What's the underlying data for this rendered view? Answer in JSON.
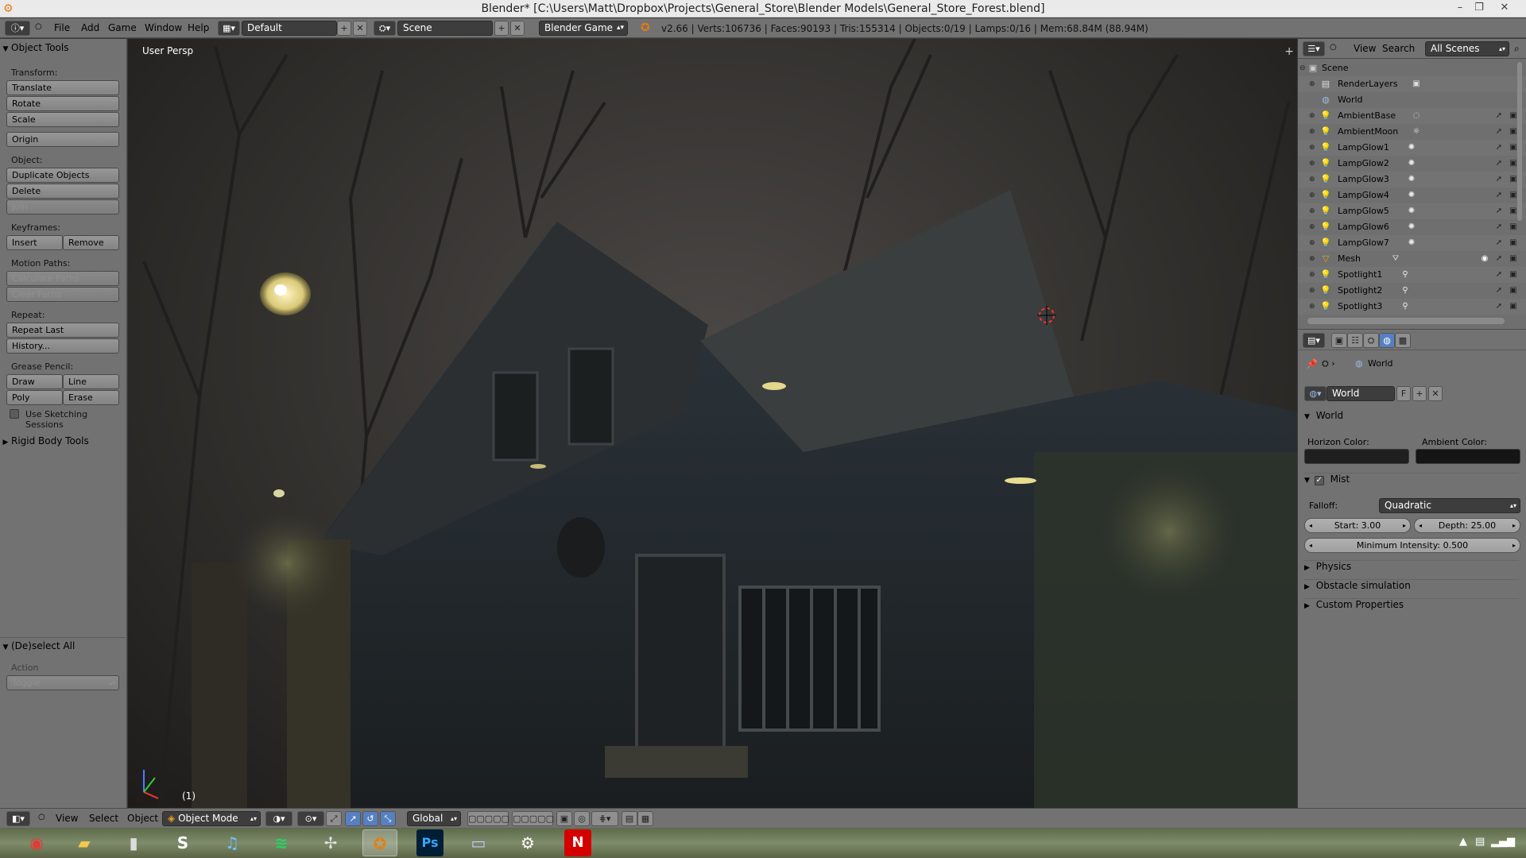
{
  "window": {
    "title": "Blender* [C:\\Users\\Matt\\Dropbox\\Projects\\General_Store\\Blender Models\\General_Store_Forest.blend]",
    "minimize": "–",
    "maximize": "❐",
    "close": "✕"
  },
  "info_header": {
    "menus": [
      "File",
      "Add",
      "Game",
      "Window",
      "Help"
    ],
    "screen_layout": "Default",
    "scene": "Scene",
    "engine": "Blender Game",
    "stats": "v2.66 | Verts:106736 | Faces:90193 | Tris:155314 | Objects:0/19 | Lamps:0/16 | Mem:68.84M (88.94M)"
  },
  "toolshelf": {
    "title": "Object Tools",
    "transform_label": "Transform:",
    "translate": "Translate",
    "rotate": "Rotate",
    "scale": "Scale",
    "origin": "Origin",
    "object_label": "Object:",
    "duplicate": "Duplicate Objects",
    "delete": "Delete",
    "join": "Join",
    "keyframes_label": "Keyframes:",
    "insert": "Insert",
    "remove": "Remove",
    "motion_label": "Motion Paths:",
    "calculate_paths": "Calculate Paths",
    "clear_paths": "Clear Paths",
    "repeat_label": "Repeat:",
    "repeat_last": "Repeat Last",
    "history": "History...",
    "grease_label": "Grease Pencil:",
    "draw": "Draw",
    "line": "Line",
    "poly": "Poly",
    "erase": "Erase",
    "sketching": "Use Sketching Sessions",
    "rigid_body": "Rigid Body Tools",
    "deselect_title": "(De)select All",
    "action_label": "Action",
    "action_value": "Toggle"
  },
  "viewport": {
    "label": "User Persp",
    "frame": "(1)"
  },
  "outliner": {
    "view": "View",
    "search": "Search",
    "filter": "All Scenes",
    "items": [
      {
        "label": "Scene",
        "icon": "scene-icon",
        "level": 0
      },
      {
        "label": "RenderLayers",
        "icon": "render-layers-icon",
        "level": 1
      },
      {
        "label": "World",
        "icon": "world-icon",
        "level": 1
      },
      {
        "label": "AmbientBase",
        "icon": "lamp-icon",
        "level": 1
      },
      {
        "label": "AmbientMoon",
        "icon": "lamp-icon",
        "level": 1
      },
      {
        "label": "LampGlow1",
        "icon": "lamp-icon",
        "level": 1
      },
      {
        "label": "LampGlow2",
        "icon": "lamp-icon",
        "level": 1
      },
      {
        "label": "LampGlow3",
        "icon": "lamp-icon",
        "level": 1
      },
      {
        "label": "LampGlow4",
        "icon": "lamp-icon",
        "level": 1
      },
      {
        "label": "LampGlow5",
        "icon": "lamp-icon",
        "level": 1
      },
      {
        "label": "LampGlow6",
        "icon": "lamp-icon",
        "level": 1
      },
      {
        "label": "LampGlow7",
        "icon": "lamp-icon",
        "level": 1
      },
      {
        "label": "Mesh",
        "icon": "mesh-icon",
        "level": 1
      },
      {
        "label": "Spotlight1",
        "icon": "lamp-icon",
        "level": 1
      },
      {
        "label": "Spotlight2",
        "icon": "lamp-icon",
        "level": 1
      },
      {
        "label": "Spotlight3",
        "icon": "lamp-icon",
        "level": 1
      }
    ]
  },
  "properties": {
    "breadcrumb": "World",
    "datablock": "World",
    "fake_user": "F",
    "world_panel": "World",
    "horizon_color_label": "Horizon Color:",
    "ambient_color_label": "Ambient Color:",
    "horizon_color": "#1f1f1f",
    "ambient_color": "#151515",
    "mist_panel": "Mist",
    "falloff_label": "Falloff:",
    "falloff_value": "Quadratic",
    "start": "Start: 3.00",
    "depth": "Depth: 25.00",
    "min_intensity": "Minimum Intensity: 0.500",
    "physics": "Physics",
    "obstacle": "Obstacle simulation",
    "custom_props": "Custom Properties"
  },
  "view3d_header": {
    "view": "View",
    "select": "Select",
    "object": "Object",
    "mode": "Object Mode",
    "orientation": "Global"
  },
  "taskbar": {
    "apps": [
      "chrome",
      "file-explorer",
      "notes",
      "steam-alt",
      "itunes",
      "spotify",
      "pinwheel",
      "blender",
      "photoshop",
      "monitor",
      "steam",
      "netflix"
    ],
    "photoshop_label": "Ps",
    "netflix_label": "N"
  }
}
